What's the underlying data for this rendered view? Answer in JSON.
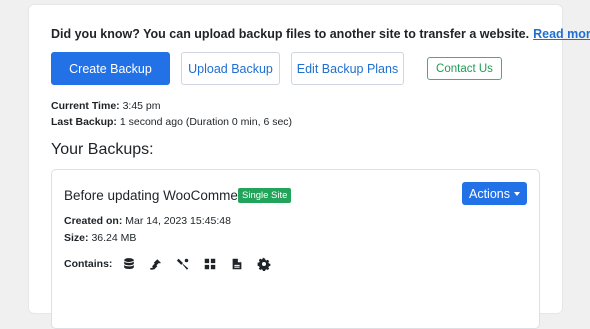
{
  "notice": {
    "text": "Did you know? You can upload backup files to another site to transfer a website.",
    "link": "Read more"
  },
  "toolbar": {
    "create_backup": "Create Backup",
    "upload_backup": "Upload Backup",
    "edit_plans": "Edit Backup Plans",
    "contact_us": "Contact Us"
  },
  "status": {
    "current_time_label": "Current Time:",
    "current_time_value": "3:45 pm",
    "last_backup_label": "Last Backup:",
    "last_backup_value": "1 second ago (Duration 0 min, 6 sec)"
  },
  "backups": {
    "heading": "Your Backups:",
    "items": [
      {
        "title": "Before updating WooCommerce",
        "badge": "Single Site",
        "actions_label": "Actions",
        "created_label": "Created on:",
        "created_value": "Mar 14, 2023 15:45:48",
        "size_label": "Size:",
        "size_value": "36.24 MB",
        "contains_label": "Contains:",
        "contains_icons": [
          "database-icon",
          "plugins-icon",
          "themes-icon",
          "media-icon",
          "files-icon",
          "settings-icon"
        ]
      }
    ]
  },
  "colors": {
    "primary": "#2271e6",
    "link": "#1f6fd0",
    "success": "#22a55b"
  }
}
